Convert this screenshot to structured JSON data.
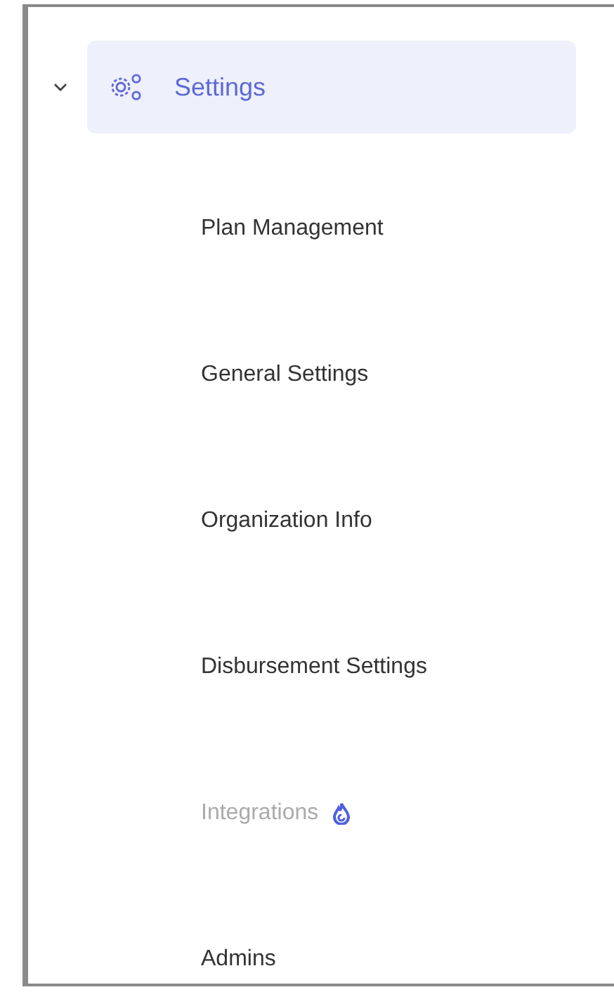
{
  "menu": {
    "label": "Settings",
    "expanded": true,
    "selected": true,
    "children": [
      {
        "label": "Plan Management",
        "disabled": false,
        "badge": false
      },
      {
        "label": "General Settings",
        "disabled": false,
        "badge": false
      },
      {
        "label": "Organization Info",
        "disabled": false,
        "badge": false
      },
      {
        "label": "Disbursement Settings",
        "disabled": false,
        "badge": false
      },
      {
        "label": "Integrations",
        "disabled": true,
        "badge": true
      },
      {
        "label": "Admins",
        "disabled": false,
        "badge": false
      }
    ]
  }
}
